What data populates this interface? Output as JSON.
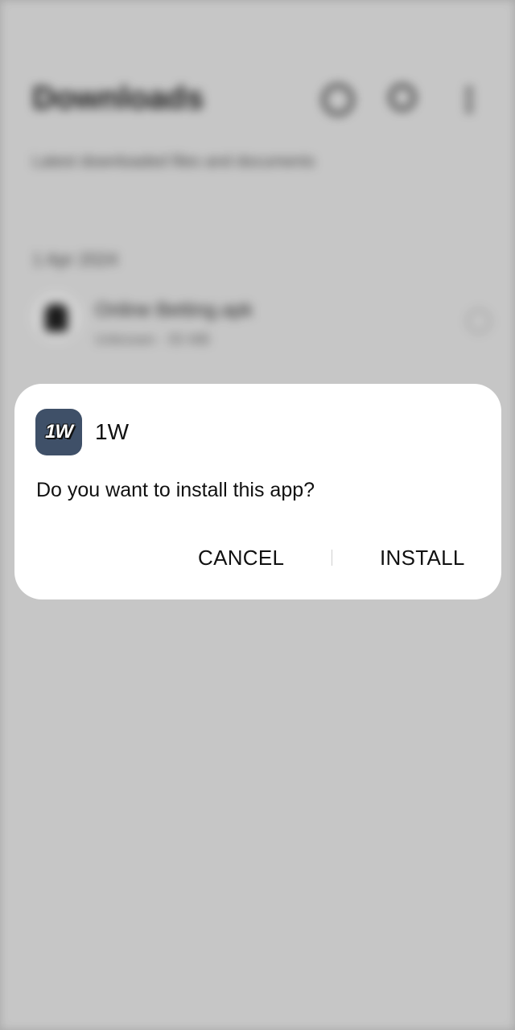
{
  "background": {
    "title": "Downloads",
    "subtitle": "Latest downloaded files and documents",
    "date": "1 Apr 2024",
    "file_name": "Online Betting.apk",
    "file_meta": "Unknown · 55 MB",
    "icons": [
      "info-icon",
      "search-icon",
      "more-vert-icon"
    ]
  },
  "dialog": {
    "app_icon_text": "1W",
    "app_name": "1W",
    "message": "Do you want to install this app?",
    "cancel_label": "CANCEL",
    "install_label": "INSTALL"
  },
  "colors": {
    "app_icon_bg": "#3f5068",
    "dialog_bg": "#ffffff",
    "scrim": "#cccccc"
  }
}
